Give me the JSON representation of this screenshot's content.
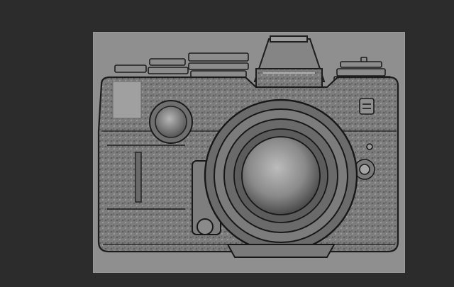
{
  "canvas": {
    "background_color": "#2b2b2b",
    "plate_color": "#8f8f8f"
  },
  "subject": {
    "icon": "camera-relief-icon",
    "material_color": "#7a7a7a",
    "highlight_color": "#bdbdbd",
    "shadow_color": "#1e1e1e"
  }
}
